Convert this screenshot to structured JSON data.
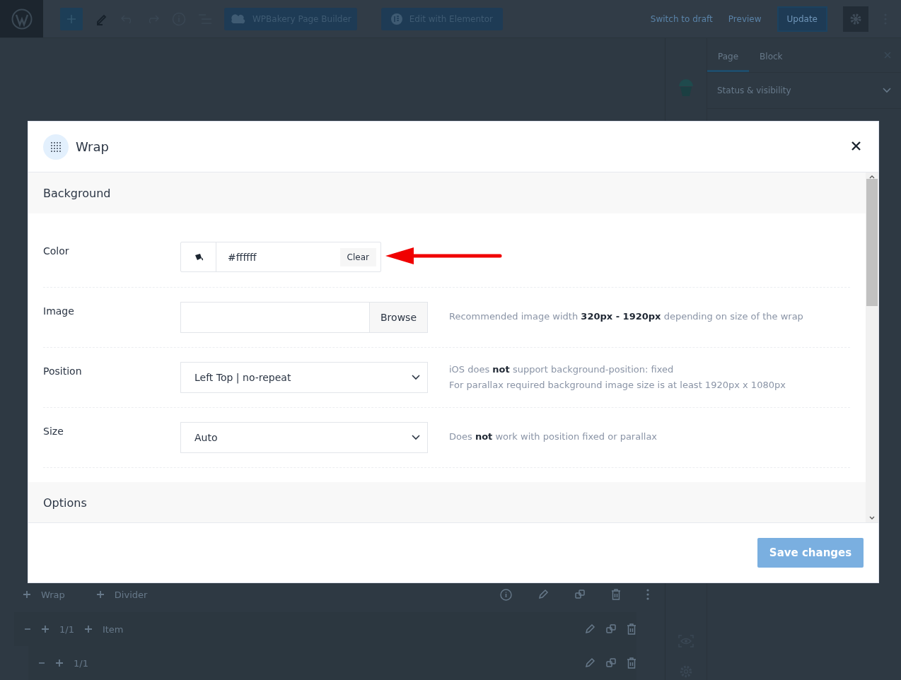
{
  "editor": {
    "toolbar": {
      "builders": [
        {
          "kind": "wpbakery",
          "label": "WPBakery Page Builder"
        },
        {
          "kind": "elementor",
          "label": "Edit with Elementor"
        }
      ],
      "actions": [
        "Switch to draft",
        "Preview"
      ],
      "update": "Update"
    },
    "canvas_rows": [
      {
        "kind": "add-bar",
        "items": [
          "Wrap",
          "Divider"
        ]
      },
      {
        "kind": "column",
        "ratio": "1/1",
        "add": "Item"
      },
      {
        "kind": "column",
        "ratio": "1/1"
      }
    ],
    "sidebar": {
      "tabs": [
        {
          "label": "Page",
          "selected": true
        },
        {
          "label": "Block",
          "selected": false
        }
      ],
      "panels": [
        "Status & visibility"
      ]
    }
  },
  "modal": {
    "title": "Wrap",
    "sections": [
      {
        "title": "Background",
        "rows": [
          {
            "kind": "color",
            "label": "Color",
            "value": "#ffffff",
            "clear": "Clear"
          },
          {
            "kind": "image",
            "label": "Image",
            "button": "Browse",
            "help": [
              "Recommended image width **320px - 1920px** depending on size of the wrap"
            ]
          },
          {
            "kind": "select",
            "label": "Position",
            "value": "Left Top | no-repeat",
            "help": [
              "iOS does **not** support background-position: fixed",
              "For parallax required background image size is at least 1920px x 1080px"
            ]
          },
          {
            "kind": "select",
            "label": "Size",
            "value": "Auto",
            "help": [
              "Does **not** work with position fixed or parallax"
            ]
          }
        ]
      },
      {
        "title": "Options"
      }
    ],
    "save": "Save changes"
  }
}
